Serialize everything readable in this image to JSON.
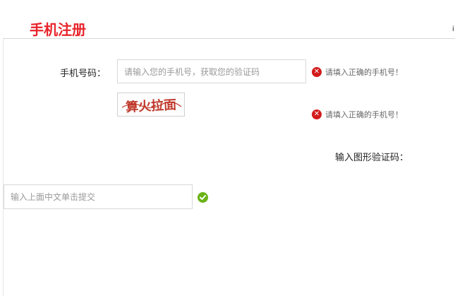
{
  "header": {
    "title": "手机注册",
    "edge_mark": "i"
  },
  "phone": {
    "label": "手机号码：",
    "placeholder": "请输入您的手机号，获取您的验证码",
    "error": "请填入正确的手机号！"
  },
  "captcha": {
    "image_text": "算火拉面",
    "error": "请填入正确的手机号！",
    "label": "输入图形验证码："
  },
  "chinese_input": {
    "placeholder": "输入上面中文单击提交",
    "status_icon": "check-circle-icon"
  },
  "colors": {
    "title": "#e8242b",
    "error_icon": "#d21b1b",
    "ok_icon": "#6bb317"
  }
}
